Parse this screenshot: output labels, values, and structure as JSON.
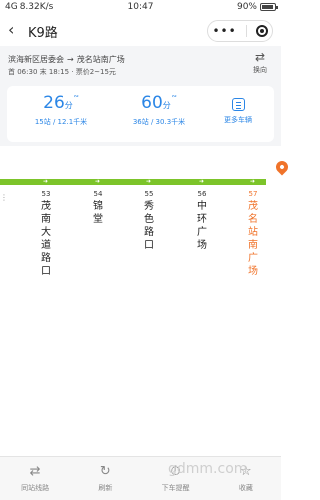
{
  "status_bar": {
    "signal": "4G",
    "speed": "8.32K/s",
    "time": "10:47",
    "battery": "90%"
  },
  "nav": {
    "back_icon": "chevron-left-icon",
    "title": "K9路",
    "menu_icon": "more-dots-icon",
    "close_icon": "target-close-icon"
  },
  "route": {
    "from": "滨海新区居委会",
    "arrow": "→",
    "to": "茂名站南广场",
    "meta": "首 06:30  末 18:15 · 票价2~15元",
    "switch_label": "换向",
    "switch_icon": "switch-direction-icon"
  },
  "arrivals": [
    {
      "minutes": "26",
      "unit": "分",
      "detail": "15站 / 12.1千米"
    },
    {
      "minutes": "60",
      "unit": "分",
      "detail": "36站 / 30.3千米"
    }
  ],
  "more_buses": {
    "label": "更多车辆",
    "icon": "list-icon"
  },
  "stations": [
    {
      "num": "53",
      "name": "茂南大道路口"
    },
    {
      "num": "54",
      "name": "锦堂"
    },
    {
      "num": "55",
      "name": "秀色路口"
    },
    {
      "num": "56",
      "name": "中环广场"
    },
    {
      "num": "57",
      "name": "茂名站南广场",
      "current": true
    }
  ],
  "colors": {
    "line": "#7cc42a",
    "accent": "#2b86e6",
    "current": "#f0732a"
  },
  "toolbar": [
    {
      "label": "同站线路",
      "icon": "transfer-icon"
    },
    {
      "label": "刷新",
      "icon": "refresh-icon"
    },
    {
      "label": "下车提醒",
      "icon": "alarm-icon"
    },
    {
      "label": "收藏",
      "icon": "star-icon"
    }
  ],
  "watermark": "gdmm.com"
}
